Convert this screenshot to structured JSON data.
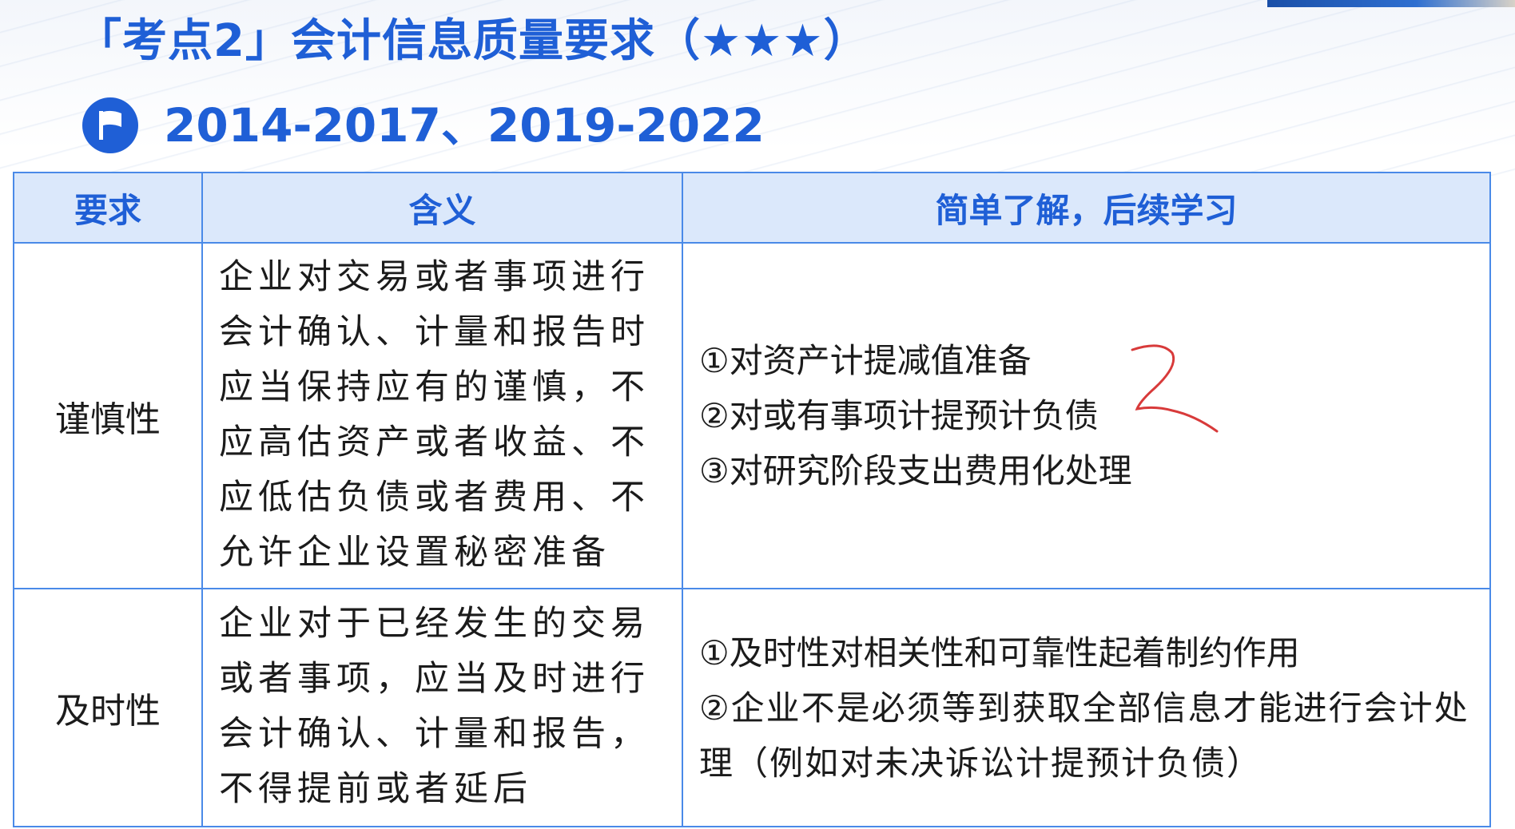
{
  "header": {
    "title": "「考点2」会计信息质量要求（★★★）",
    "years": "2014-2017、2019-2022",
    "flag_icon": "flag-icon",
    "accent_color": "#1f5fd6"
  },
  "table": {
    "columns": [
      "要求",
      "含义",
      "简单了解，后续学习"
    ],
    "rows": [
      {
        "requirement": "谨慎性",
        "meaning": "企业对交易或者事项进行会计确认、计量和报告时应当保持应有的谨慎，不应高估资产或者收益、不应低估负债或者费用、不允许企业设置秘密准备",
        "notes": [
          "①对资产计提减值准备",
          "②对或有事项计提预计负债",
          "③对研究阶段支出费用化处理"
        ]
      },
      {
        "requirement": "及时性",
        "meaning": "企业对于已经发生的交易或者事项，应当及时进行会计确认、计量和报告，不得提前或者延后",
        "notes": [
          "①及时性对相关性和可靠性起着制约作用",
          "②企业不是必须等到获取全部信息才能进行会计处理（例如对未决诉讼计提预计负债）"
        ]
      }
    ]
  },
  "annotation": {
    "handwritten_mark": "2",
    "mark_color": "#d83a3a"
  }
}
